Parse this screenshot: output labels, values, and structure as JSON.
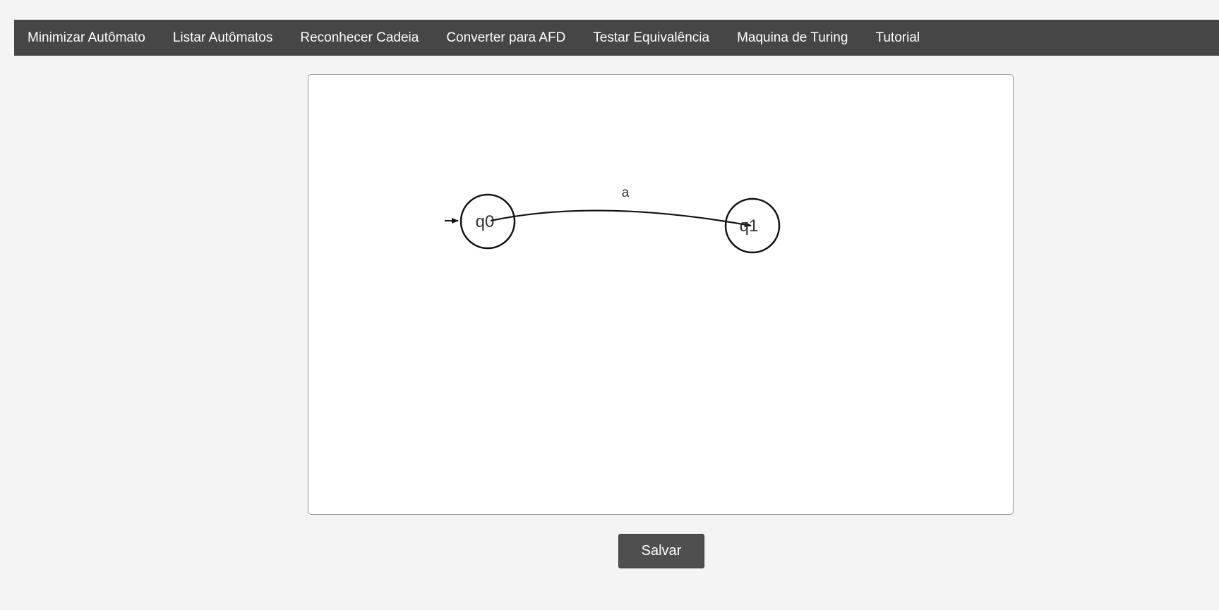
{
  "nav": {
    "items": [
      {
        "label": "Minimizar Autômato"
      },
      {
        "label": "Listar Autômatos"
      },
      {
        "label": "Reconhecer Cadeia"
      },
      {
        "label": "Converter para AFD"
      },
      {
        "label": "Testar Equivalência"
      },
      {
        "label": "Maquina de Turing"
      },
      {
        "label": "Tutorial"
      }
    ]
  },
  "automaton": {
    "states": [
      {
        "id": "q0",
        "label": "q0",
        "initial": true
      },
      {
        "id": "q1",
        "label": "q1",
        "initial": false
      }
    ],
    "transitions": [
      {
        "from": "q0",
        "to": "q1",
        "label": "a"
      }
    ]
  },
  "actions": {
    "save_label": "Salvar"
  },
  "colors": {
    "navbar": "#464646",
    "button": "#4f4f4f",
    "stroke": "#111111"
  }
}
